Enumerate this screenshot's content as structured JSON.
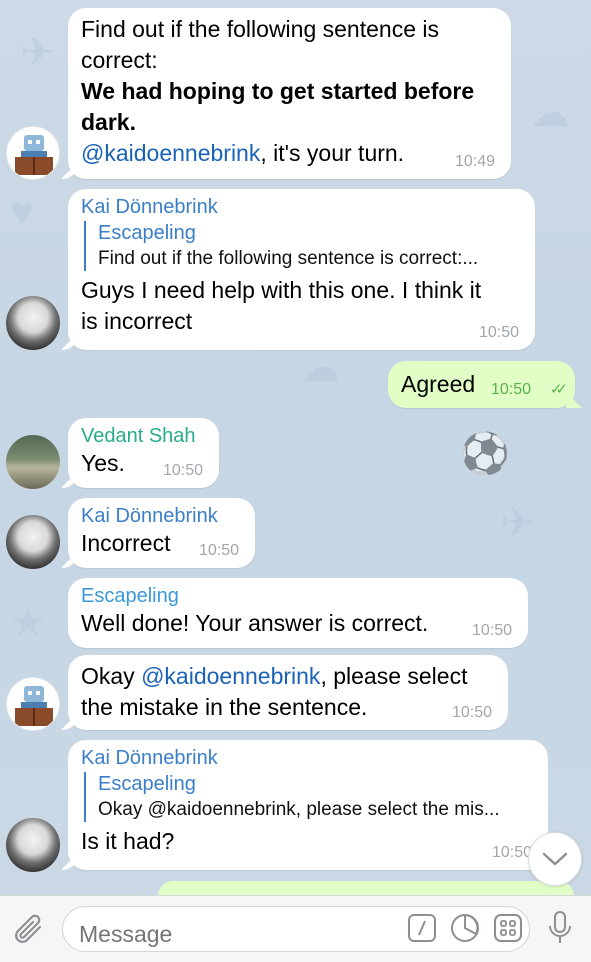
{
  "messages": {
    "m1": {
      "line1": "Find out if the following sentence is",
      "line2": "correct:",
      "bold1": "We had hoping to get started before",
      "bold2": "dark.",
      "mention": "@kaidoennebrink",
      "suffix": ", it's your turn.",
      "time": "10:49"
    },
    "m2": {
      "sender": "Kai Dönnebrink",
      "reply_name": "Escapeling",
      "reply_text": "Find out if the following sentence is correct:...",
      "line1": "Guys I need help with this one. I think it",
      "line2": "is incorrect",
      "time": "10:50"
    },
    "m3": {
      "text": "Agreed",
      "time": "10:50"
    },
    "m4": {
      "sender": "Vedant Shah",
      "text": "Yes.",
      "time": "10:50"
    },
    "m5": {
      "sender": "Kai Dönnebrink",
      "text": "Incorrect",
      "time": "10:50"
    },
    "m6": {
      "sender": "Escapeling",
      "text": "Well done! Your answer is correct.",
      "time": "10:50"
    },
    "m7": {
      "prefix": "Okay ",
      "mention": "@kaidoennebrink",
      "suffix": ", please select",
      "line2": "the mistake in the sentence.",
      "time": "10:50"
    },
    "m8": {
      "sender": "Kai Dönnebrink",
      "reply_name": "Escapeling",
      "reply_text": "Okay @kaidoennebrink, please select the mis...",
      "text": "Is it had?",
      "time": "10:50"
    }
  },
  "composer": {
    "placeholder": "Message"
  },
  "icons": {
    "attach": "paperclip-icon",
    "commands": "slash-command-icon",
    "timer": "timer-icon",
    "keyboard": "bot-keyboard-icon",
    "mic": "microphone-icon",
    "scroll": "chevron-down-icon"
  },
  "colors": {
    "incoming_bubble": "#ffffff",
    "outgoing_bubble": "#e1fec6",
    "link": "#1a62b8",
    "sender_blue": "#3a7fc7",
    "sender_green": "#2aab8d"
  }
}
